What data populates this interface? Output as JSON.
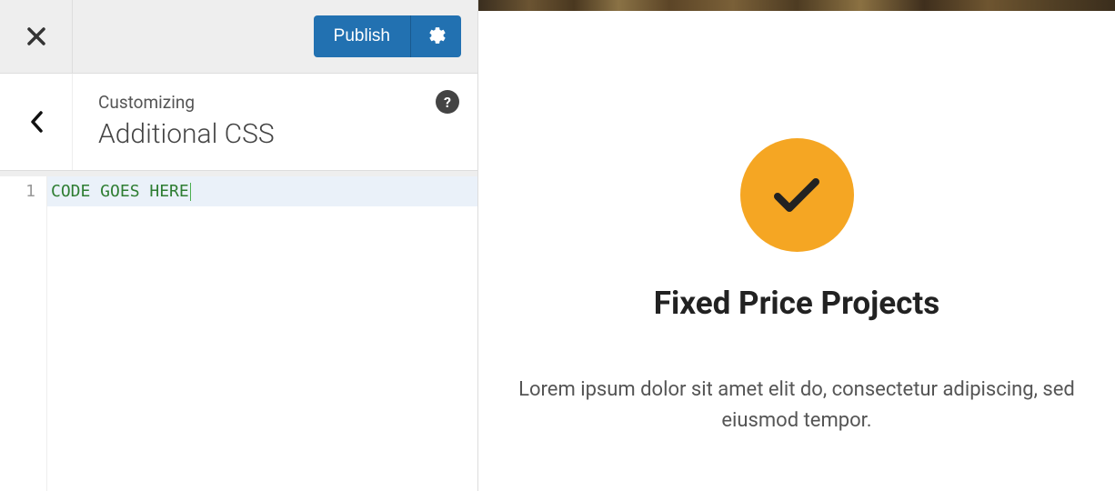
{
  "topbar": {
    "publish_label": "Publish"
  },
  "header": {
    "breadcrumb": "Customizing",
    "title": "Additional CSS",
    "help_label": "?"
  },
  "editor": {
    "line_number": "1",
    "code": "CODE GOES HERE"
  },
  "preview": {
    "heading": "Fixed Price Projects",
    "body": "Lorem ipsum dolor sit amet elit do, consectetur adipiscing, sed eiusmod tempor."
  }
}
